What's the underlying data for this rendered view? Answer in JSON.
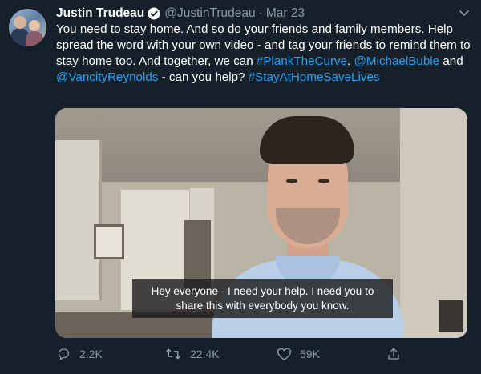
{
  "tweet": {
    "author_name": "Justin Trudeau",
    "handle": "@JustinTrudeau",
    "separator": "·",
    "date": "Mar 23",
    "text_segments": [
      {
        "type": "text",
        "value": "You need to stay home. And so do your friends and family members. Help spread the word with your own video - and tag your friends to remind them to stay home too. And together, we can "
      },
      {
        "type": "link",
        "value": "#PlankTheCurve"
      },
      {
        "type": "text",
        "value": ". "
      },
      {
        "type": "link",
        "value": "@MichaelBuble"
      },
      {
        "type": "text",
        "value": " and "
      },
      {
        "type": "link",
        "value": "@VancityReynolds"
      },
      {
        "type": "text",
        "value": " - can you help? "
      },
      {
        "type": "link",
        "value": "#StayAtHomeSaveLives"
      }
    ],
    "video_caption": "Hey everyone - I need your help. I need you to share this with everybody you know."
  },
  "actions": {
    "reply_count": "2.2K",
    "retweet_count": "22.4K",
    "like_count": "59K"
  },
  "icons": {
    "verified": "verified-badge-icon",
    "caret": "chevron-down-icon",
    "reply": "reply-icon",
    "retweet": "retweet-icon",
    "like": "heart-icon",
    "share": "share-icon"
  },
  "colors": {
    "background": "#15202b",
    "link": "#1da1f2",
    "muted": "#8899a6",
    "text": "#ffffff"
  }
}
